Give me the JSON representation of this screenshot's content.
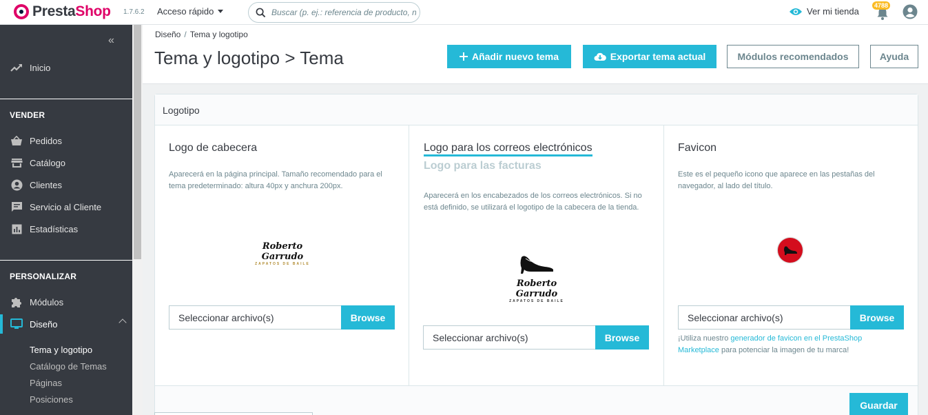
{
  "header": {
    "brand_a": "Presta",
    "brand_b": "Shop",
    "version": "1.7.6.2",
    "quick_access": "Acceso rápido",
    "search_placeholder": "Buscar (p. ej.: referencia de producto, nombre de cliente...)",
    "view_shop": "Ver mi tienda",
    "notifications_count": "4788"
  },
  "sidebar": {
    "collapse_icon": "«",
    "home": "Inicio",
    "section_sell": "VENDER",
    "orders": "Pedidos",
    "catalog": "Catálogo",
    "customers": "Clientes",
    "customer_service": "Servicio al Cliente",
    "stats": "Estadísticas",
    "section_customize": "PERSONALIZAR",
    "modules": "Módulos",
    "design": "Diseño",
    "design_sub": [
      "Tema y logotipo",
      "Catálogo de Temas",
      "Páginas",
      "Posiciones"
    ]
  },
  "page": {
    "breadcrumb": [
      "Diseño",
      "Tema y logotipo"
    ],
    "title": "Tema y logotipo > Tema",
    "btn_add_theme": "Añadir nuevo tema",
    "btn_export": "Exportar tema actual",
    "btn_modules": "Módulos recomendados",
    "btn_help": "Ayuda"
  },
  "card": {
    "title": "Logotipo",
    "header_logo": {
      "title": "Logo de cabecera",
      "desc": "Aparecerá en la página principal. Tamaño recomendado para el tema predeterminado: altura 40px y anchura 200px.",
      "file_placeholder": "Seleccionar archivo(s)",
      "browse": "Browse"
    },
    "mail_logo": {
      "tab_active": "Logo para los correos electrónicos",
      "tab_inactive": "Logo para las facturas",
      "desc": "Aparecerá en los encabezados de los correos electrónicos. Si no está definido, se utilizará el logotipo de la cabecera de la tienda.",
      "file_placeholder": "Seleccionar archivo(s)",
      "browse": "Browse"
    },
    "favicon": {
      "title": "Favicon",
      "desc": "Este es el pequeño icono que aparece en las pestañas del navegador, al lado del título.",
      "file_placeholder": "Seleccionar archivo(s)",
      "browse": "Browse",
      "hint_before": "¡Utiliza nuestro ",
      "hint_link": "generador de favicon en el PrestaShop Marketplace",
      "hint_after": " para potenciar la imagen de tu marca!"
    },
    "logo_brand": "Roberto Garrudo",
    "logo_tagline": "ZAPATOS DE BAILE",
    "save": "Guardar"
  },
  "colors": {
    "accent": "#25b9d7",
    "brand_pink": "#df0067",
    "sidebar_bg": "#363a41",
    "badge": "#fbbb22"
  },
  "icons": {
    "search": "search-icon",
    "eye": "eye-icon",
    "bell": "bell-icon",
    "user": "user-avatar-icon"
  }
}
